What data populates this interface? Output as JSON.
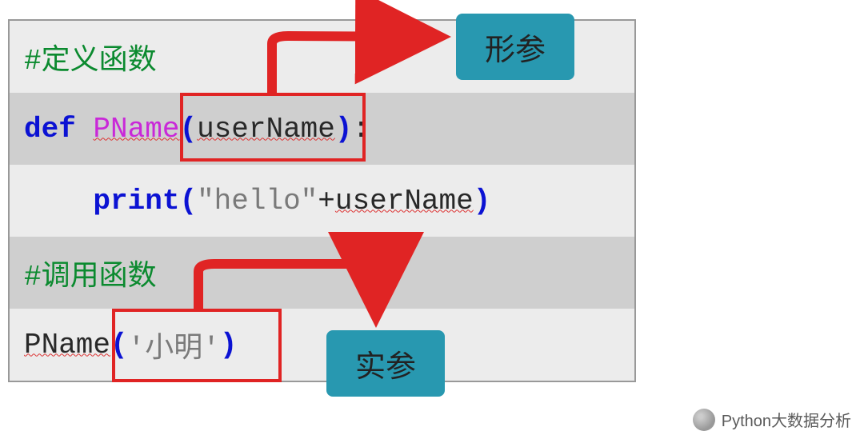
{
  "code": {
    "comment_define": "#定义函数",
    "kw_def": "def",
    "fn_name": "PName",
    "paren_open": "(",
    "param_name": "userName",
    "paren_close": ")",
    "colon": ":",
    "indent_print": "    ",
    "kw_print": "print",
    "print_open": "(",
    "str_hello": "\"hello\"",
    "plus": "+",
    "print_arg": "userName",
    "print_close": ")",
    "comment_call": "#调用函数",
    "call_name": "PName",
    "call_open": "(",
    "call_arg": "'小明'",
    "call_close": ")"
  },
  "labels": {
    "formal_param": "形参",
    "actual_param": "实参"
  },
  "watermark": {
    "text": "Python大数据分析"
  }
}
